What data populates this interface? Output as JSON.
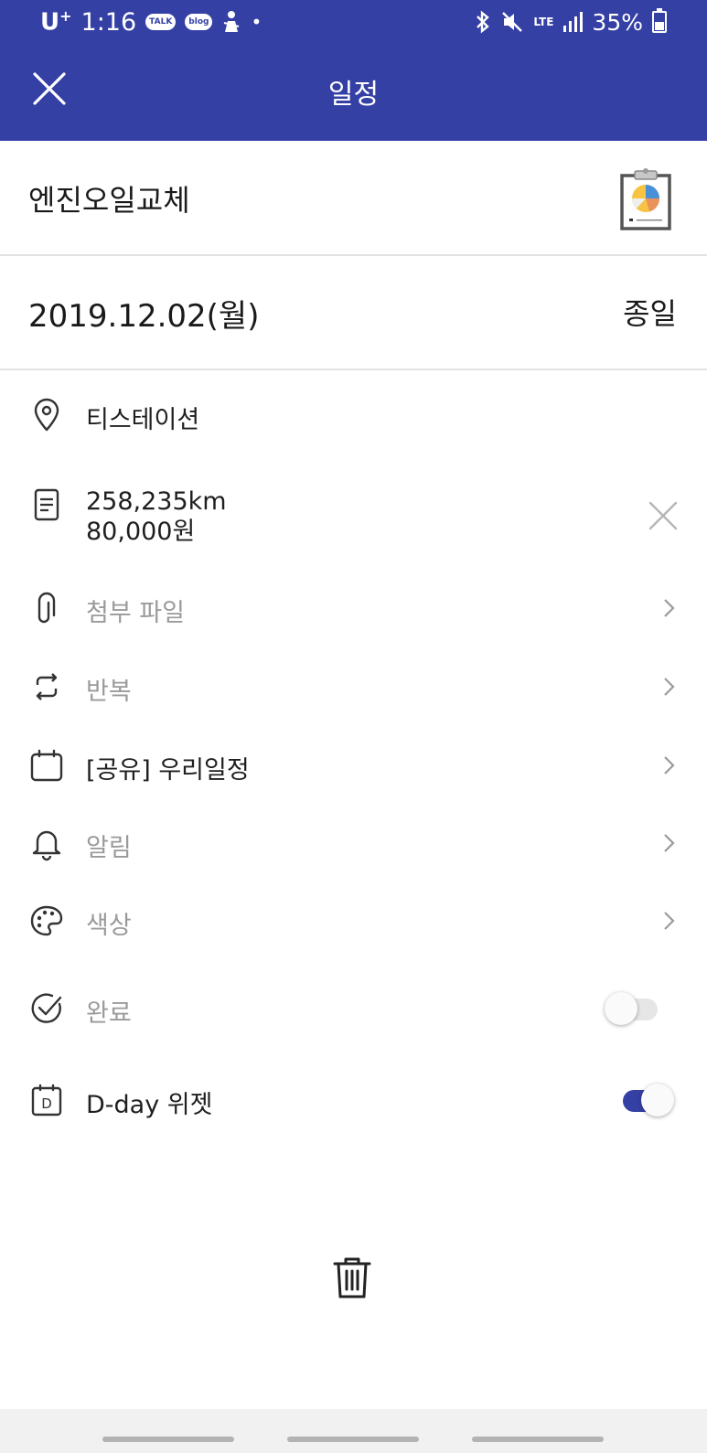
{
  "status_bar": {
    "carrier": "U",
    "carrier_sup": "+",
    "time": "1:16",
    "talk_badge": "TALK",
    "blog_badge": "blog",
    "dot": "•",
    "network": "LTE",
    "battery": "35%"
  },
  "app_bar": {
    "title": "일정"
  },
  "event": {
    "title": "엔진오일교체",
    "date": "2019.12.02(월)",
    "all_day": "종일",
    "location": "티스테이션",
    "memo_line1": "258,235km",
    "memo_line2": "80,000원",
    "attachment": "첨부 파일",
    "repeat": "반복",
    "calendar": "[공유] 우리일정",
    "alarm": "알림",
    "color": "색상",
    "complete": "완료",
    "complete_on": false,
    "dday_widget": "D-day 위젯",
    "dday_on": true
  },
  "icons": {
    "close": "close-icon",
    "sticker": "clipboard-chart-icon",
    "location": "location-pin-icon",
    "memo": "memo-icon",
    "clear": "clear-icon",
    "attachment": "paperclip-icon",
    "repeat": "repeat-icon",
    "calendar": "calendar-icon",
    "alarm": "bell-icon",
    "color": "palette-icon",
    "complete": "check-circle-icon",
    "dday": "dday-icon",
    "chevron": "chevron-right-icon",
    "delete": "trash-icon"
  },
  "colors": {
    "primary": "#3540a5",
    "muted_text": "#9a9a9a",
    "divider": "#e2e2e2"
  }
}
